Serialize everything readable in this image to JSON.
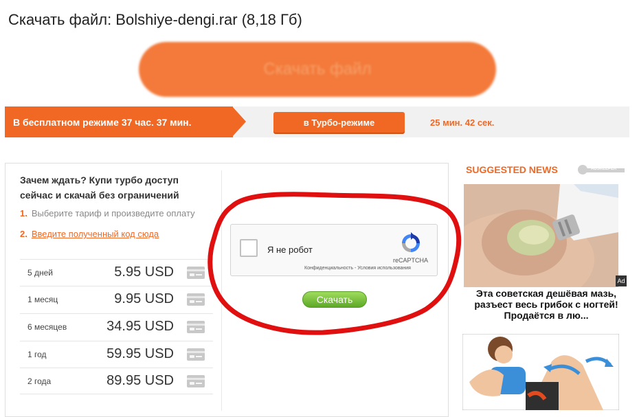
{
  "page": {
    "title": "Скачать файл: Bolshiye-dengi.rar (8,18 Гб)",
    "main_button_label": "Скачать файл"
  },
  "modes": {
    "free_label": "В бесплатном режиме 37 час. 37 мин.",
    "turbo_button": "в Турбо-режиме",
    "turbo_time": "25 мин. 42 сек."
  },
  "turbo": {
    "heading": "Зачем ждать? Купи турбо доступ сейчас и скачай без ограничений",
    "steps": [
      {
        "num": "1.",
        "text": "Выберите тариф и произведите оплату"
      },
      {
        "num": "2.",
        "text": "Введите полученный код сюда"
      }
    ],
    "plans": [
      {
        "period": "5 дней",
        "price": "5.95 USD"
      },
      {
        "period": "1 месяц",
        "price": "9.95 USD"
      },
      {
        "period": "6 месяцев",
        "price": "34.95 USD"
      },
      {
        "period": "1 год",
        "price": "59.95 USD"
      },
      {
        "period": "2 года",
        "price": "89.95 USD"
      }
    ]
  },
  "captcha": {
    "label": "Я не робот",
    "brand": "reCAPTCHA",
    "links": "Конфиденциальность - Условия использования"
  },
  "download_button": "Скачать",
  "sidebar": {
    "heading": "SUGGESTED NEWS",
    "adkeeper_label": "ADSKEEPER",
    "ad_badge": "Ad",
    "news": [
      {
        "caption": "Эта советская дешёвая мазь, разъест весь грибок с ногтей! Продаётся в лю..."
      }
    ]
  },
  "colors": {
    "accent": "#f06823",
    "green_button": "#6cb92f",
    "red_annotation": "#e01010"
  }
}
